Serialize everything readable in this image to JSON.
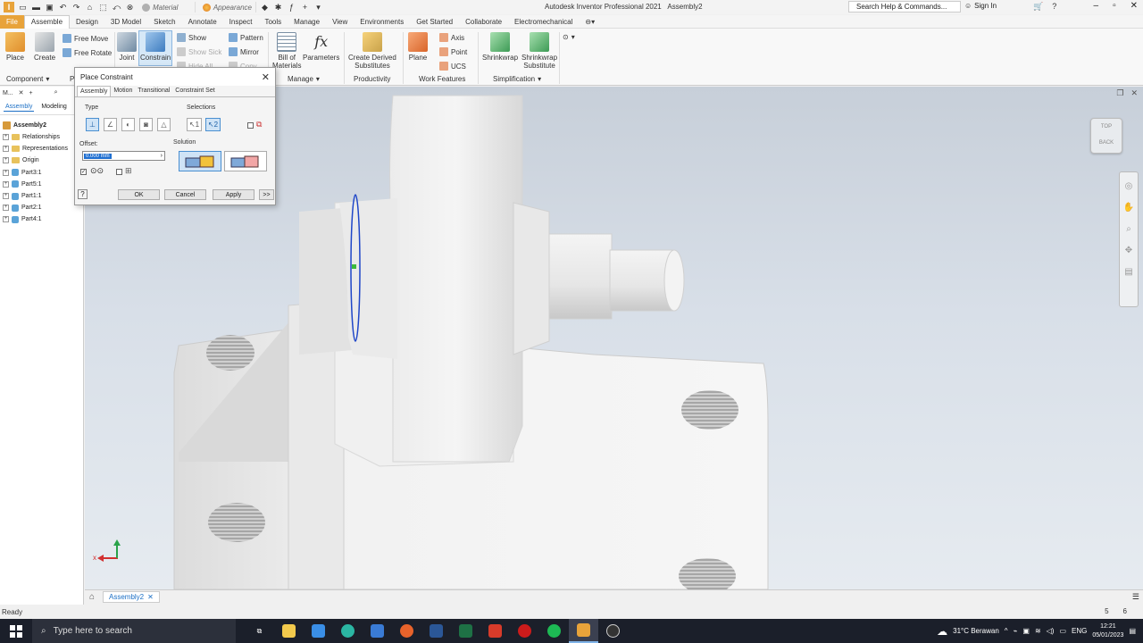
{
  "titlebar": {
    "material_label": "Material",
    "appearance_label": "Appearance",
    "app_title": "Autodesk Inventor Professional 2021",
    "doc_title": "Assembly2",
    "search_placeholder": "Search Help & Commands...",
    "sign_in": "Sign In"
  },
  "tabs": [
    "File",
    "Assemble",
    "Design",
    "3D Model",
    "Sketch",
    "Annotate",
    "Inspect",
    "Tools",
    "Manage",
    "View",
    "Environments",
    "Get Started",
    "Collaborate",
    "Electromechanical"
  ],
  "ribbon": {
    "place": "Place",
    "create": "Create",
    "free_move": "Free Move",
    "free_rotate": "Free Rotate",
    "joint": "Joint",
    "constrain": "Constrain",
    "show": "Show",
    "show_sick": "Show Sick",
    "hide_all": "Hide All",
    "pattern": "Pattern",
    "mirror": "Mirror",
    "copy": "Copy",
    "bom_line1": "Bill of",
    "bom_line2": "Materials",
    "parameters": "Parameters",
    "derived_line1": "Create Derived",
    "derived_line2": "Substitutes",
    "plane": "Plane",
    "axis": "Axis",
    "point": "Point",
    "ucs": "UCS",
    "shrinkwrap": "Shrinkwrap",
    "shrinkwrap_sub_line1": "Shrinkwrap",
    "shrinkwrap_sub_line2": "Substitute",
    "panels": {
      "component": "Component",
      "p": "P",
      "manage": "Manage",
      "productivity": "Productivity",
      "work_features": "Work Features",
      "simplification": "Simplification"
    }
  },
  "browser": {
    "top_label": "M...",
    "tab_assembly": "Assembly",
    "tab_modeling": "Modeling",
    "root": "Assembly2",
    "items": [
      "Relationships",
      "Representations",
      "Origin",
      "Part3:1",
      "Part5:1",
      "Part1:1",
      "Part2:1",
      "Part4:1"
    ]
  },
  "dialog": {
    "title": "Place Constraint",
    "tabs": [
      "Assembly",
      "Motion",
      "Transitional",
      "Constraint Set"
    ],
    "type_label": "Type",
    "selections_label": "Selections",
    "offset_label": "Offset:",
    "offset_value": "0.000 mm",
    "solution_label": "Solution",
    "sel1": "1",
    "sel2": "2",
    "ok": "OK",
    "cancel": "Cancel",
    "apply": "Apply",
    "more": ">>"
  },
  "viewcube": {
    "top": "TOP",
    "back": "BACK"
  },
  "axes": {
    "x": "x"
  },
  "doc_tab": "Assembly2",
  "status": {
    "text": "Ready",
    "n1": "5",
    "n2": "6"
  },
  "taskbar": {
    "search": "Type here to search",
    "weather": "31°C  Berawan",
    "lang": "ENG",
    "time": "12:21",
    "date": "05/01/2023"
  },
  "colors": {
    "accent": "#e8a33a",
    "selection": "#1f6fd1"
  }
}
